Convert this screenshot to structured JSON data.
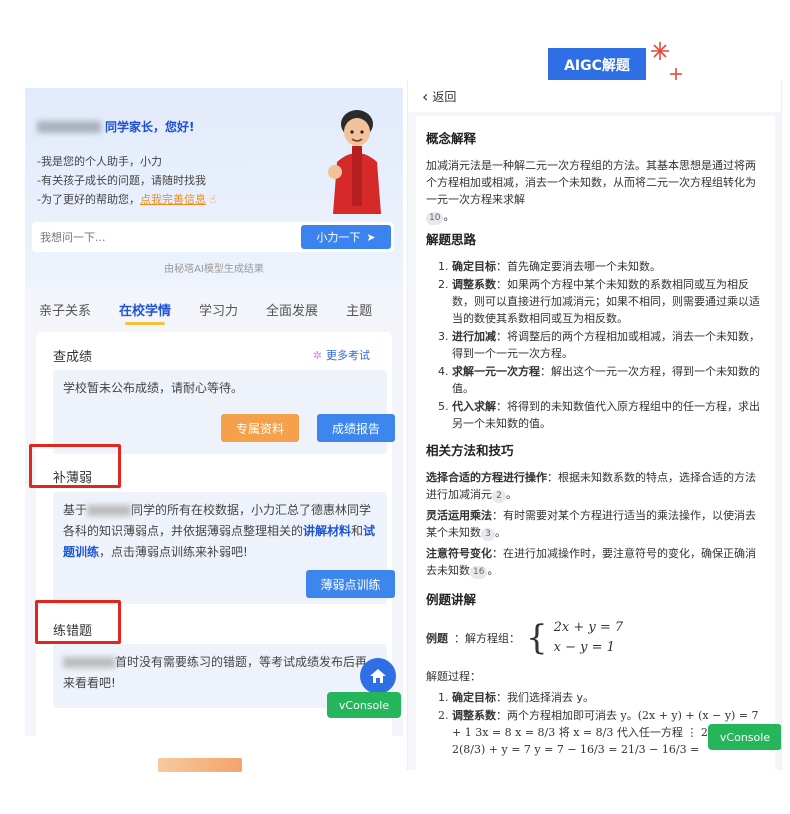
{
  "left": {
    "greeting": "同学家长，您好!",
    "intro_lines": [
      "-我是您的个人助手，小力",
      "-有关孩子成长的问题，请随时找我",
      "-为了更好的帮助您，"
    ],
    "intro_link": "点我完善信息",
    "search_placeholder": "我想问一下...",
    "ask_button": "小力一下",
    "generated_note": "由秘塔AI模型生成结果",
    "tabs": [
      "亲子关系",
      "在校学情",
      "学习力",
      "全面发展",
      "主题"
    ],
    "scores": {
      "title": "查成绩",
      "more": "更多考试",
      "message": "学校暂未公布成绩，请耐心等待。",
      "btn_materials": "专属资料",
      "btn_report": "成绩报告"
    },
    "weak": {
      "title": "补薄弱",
      "text_a": "基于",
      "text_b": "同学的所有在校数据，小力汇总了德惠林同学各科的知识薄弱点，并依据薄弱点整理相关的",
      "hl1": "讲解材料",
      "text_c": "和",
      "hl2": "试题训练",
      "text_d": "，点击薄弱点训练来补弱吧!",
      "button": "薄弱点训练"
    },
    "mistakes": {
      "title": "练错题",
      "text": "首时没有需要练习的错题，等考试成绩发布后再来看看吧!"
    },
    "vconsole": "vConsole"
  },
  "badge": "AIGC解题",
  "right": {
    "back": "返回",
    "sec1_title": "概念解释",
    "sec1_text": "加减消元法是一种解二元一次方程组的方法。其基本思想是通过将两个方程相加或相减，消去一个未知数，从而将二元一次方程组转化为一元一次方程来求解",
    "sec1_ref": "10",
    "sec2_title": "解题思路",
    "steps": [
      {
        "label": "确定目标",
        "text": "：首先确定要消去哪一个未知数。"
      },
      {
        "label": "调整系数",
        "text": "：如果两个方程中某个未知数的系数相同或互为相反数，则可以直接进行加减消元；如果不相同，则需要通过乘以适当的数使其系数相同或互为相反数。"
      },
      {
        "label": "进行加减",
        "text": "：将调整后的两个方程相加或相减，消去一个未知数，得到一个一元一次方程。"
      },
      {
        "label": "求解一元一次方程",
        "text": "：解出这个一元一次方程，得到一个未知数的值。"
      },
      {
        "label": "代入求解",
        "text": "：将得到的未知数值代入原方程组中的任一方程，求出另一个未知数的值。"
      }
    ],
    "sec3_title": "相关方法和技巧",
    "tips": [
      {
        "label": "选择合适的方程进行操作",
        "text": "：根据未知数系数的特点，选择合适的方法进行加减消元",
        "ref": "2"
      },
      {
        "label": "灵活运用乘法",
        "text": "：有时需要对某个方程进行适当的乘法操作，以使消去某个未知数",
        "ref": "3"
      },
      {
        "label": "注意符号变化",
        "text": "：在进行加减操作时，要注意符号的变化，确保正确消去未知数",
        "ref": "16"
      }
    ],
    "sec4_title": "例题讲解",
    "example_label": "例题",
    "example_text": "：解方程组：",
    "eq1": "2x + y = 7",
    "eq2": "x − y = 1",
    "process_title": "解题过程",
    "proc": [
      {
        "label": "确定目标",
        "text": "：我们选择消去 y。"
      },
      {
        "label": "调整系数",
        "text": "：两个方程相加即可消去 y。(2x + y) + (x − y) = 7 + 1 3x = 8 x = 8/3 将 x = 8/3 代入任一方程 ⋮ 2x + y = 7 2(8/3) + y = 7 y = 7 − 16/3 = 21/3 − 16/3 ="
      }
    ],
    "vconsole": "vConsole"
  }
}
